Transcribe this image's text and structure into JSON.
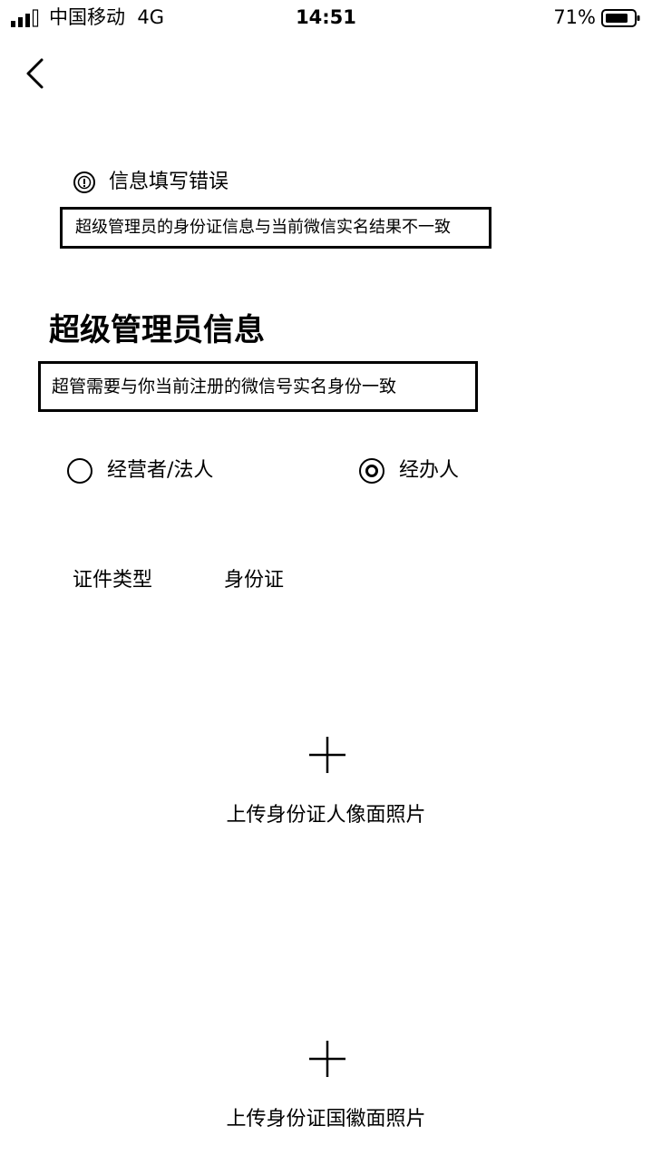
{
  "status_bar": {
    "carrier": "中国移动",
    "network": "4G",
    "time": "14:51",
    "battery_percent": "71%",
    "signal_icon": "signal-icon",
    "battery_icon": "battery-icon"
  },
  "nav": {
    "back_icon": "chevron-left-icon"
  },
  "error": {
    "icon": "info-circle-icon",
    "title": "信息填写错误",
    "message": "超级管理员的身份证信息与当前微信实名结果不一致"
  },
  "section": {
    "title": "超级管理员信息",
    "hint": "超管需要与你当前注册的微信号实名身份一致"
  },
  "role_options": [
    {
      "label": "经营者/法人",
      "selected": false
    },
    {
      "label": "经办人",
      "selected": true
    }
  ],
  "id_type": {
    "label": "证件类型",
    "value": "身份证"
  },
  "uploads": [
    {
      "icon": "plus-icon",
      "label": "上传身份证人像面照片"
    },
    {
      "icon": "plus-icon",
      "label": "上传身份证国徽面照片"
    }
  ]
}
